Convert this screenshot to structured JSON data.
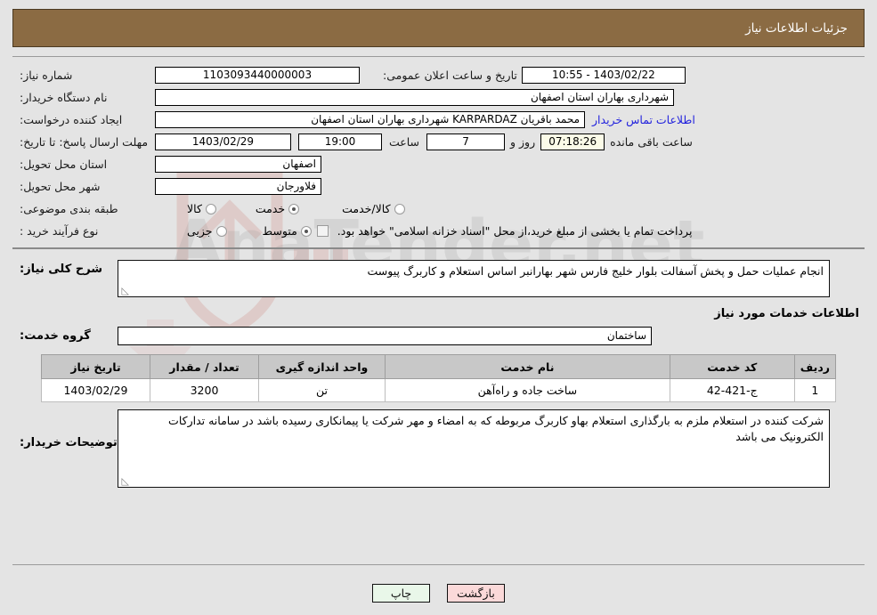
{
  "header": {
    "title": "جزئیات اطلاعات نیاز",
    "bar_color": "#8b6b43"
  },
  "top_form": {
    "need_number_label": "شماره نیاز:",
    "need_number_value": "1103093440000003",
    "public_announce_label": "تاریخ و ساعت اعلان عمومی:",
    "public_announce_value": "1403/02/22 - 10:55",
    "buyer_org_label": "نام دستگاه خریدار:",
    "buyer_org_value": "شهرداری بهاران استان اصفهان",
    "creator_label": "ایجاد کننده درخواست:",
    "creator_value": "محمد باقریان KARPARDAZ شهرداری بهاران استان اصفهان",
    "contact_link": "اطلاعات تماس خریدار",
    "deadline_label": "مهلت ارسال پاسخ: تا تاریخ:",
    "deadline_date": "1403/02/29",
    "deadline_hour_label": "ساعت",
    "deadline_hour": "19:00",
    "remaining_days": "7",
    "days_and_label": "روز و",
    "remaining_time": "07:18:26",
    "remaining_label": "ساعت باقی مانده",
    "province_label": "استان محل تحویل:",
    "province_value": "اصفهان",
    "city_label": "شهر محل تحویل:",
    "city_value": "فلاورجان",
    "category_label": "طبقه بندی موضوعی:",
    "category_options": [
      {
        "label": "کالا",
        "selected": false
      },
      {
        "label": "خدمت",
        "selected": true
      },
      {
        "label": "کالا/خدمت",
        "selected": false
      }
    ],
    "process_label": "نوع فرآیند خرید :",
    "process_options": [
      {
        "label": "جزیی",
        "selected": false
      },
      {
        "label": "متوسط",
        "selected": true
      }
    ],
    "treasury_checkbox_checked": false,
    "treasury_text": "پرداخت تمام یا بخشی از مبلغ خرید،از محل \"اسناد خزانه اسلامی\" خواهد بود."
  },
  "description": {
    "label": "شرح کلی نیاز:",
    "value": "انجام عملیات حمل و پخش آسفالت  بلوار خلیج فارس شهر بهارانبر اساس استعلام و کاربرگ پیوست"
  },
  "services_section": {
    "heading": "اطلاعات خدمات مورد نیاز",
    "group_label": "گروه خدمت:",
    "group_value": "ساختمان"
  },
  "table": {
    "columns": [
      "ردیف",
      "کد خدمت",
      "نام خدمت",
      "واحد اندازه گیری",
      "تعداد / مقدار",
      "تاریخ نیاز"
    ],
    "rows": [
      {
        "index": "1",
        "service_code": "ج-421-42",
        "service_name": "ساخت جاده و راه‌آهن",
        "unit": "تن",
        "quantity": "3200",
        "need_date": "1403/02/29"
      }
    ]
  },
  "buyer_notes": {
    "label": "توضیحات خریدار:",
    "value": "شرکت کننده  در استعلام ملزم به بارگذاری استعلام بهاو کاربرگ مربوطه که به امضاء و مهر شرکت یا پیمانکاری رسیده باشد در سامانه تدارکات الکترونیک می باشد"
  },
  "buttons": {
    "print": "چاپ",
    "back": "بازگشت"
  }
}
